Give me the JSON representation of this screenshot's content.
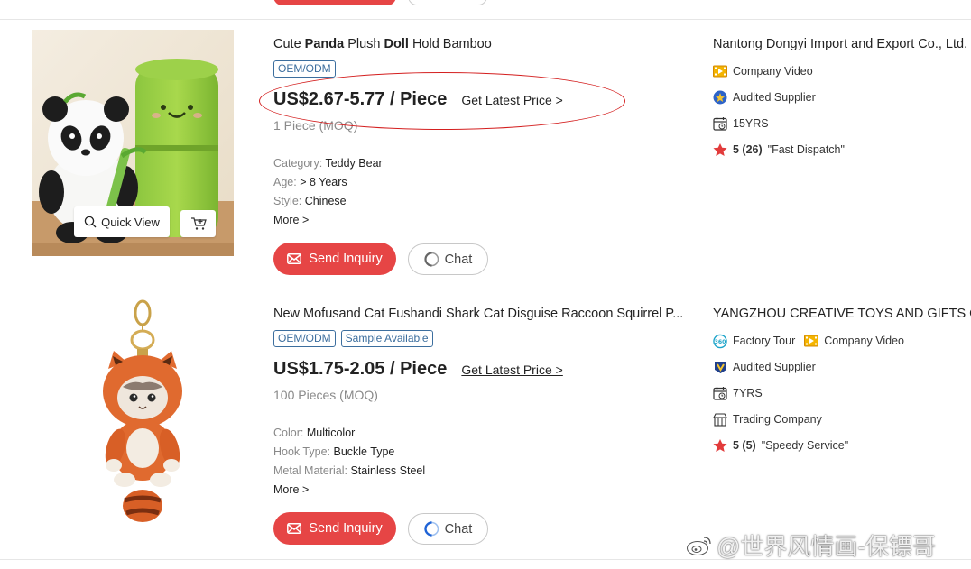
{
  "products": [
    {
      "title_parts": [
        {
          "text": "Cute ",
          "bold": false
        },
        {
          "text": "Panda",
          "bold": true
        },
        {
          "text": " Plush ",
          "bold": false
        },
        {
          "text": "Doll",
          "bold": true
        },
        {
          "text": " Hold Bamboo",
          "bold": false
        }
      ],
      "tags": [
        "OEM/ODM"
      ],
      "price": "US$2.67-5.77 / Piece",
      "latest_price_link": "Get Latest Price >",
      "moq": "1 Piece (MOQ)",
      "attributes": [
        {
          "key": "Category: ",
          "value": "Teddy Bear"
        },
        {
          "key": "Age: ",
          "value": "> 8 Years"
        },
        {
          "key": "Style: ",
          "value": "Chinese"
        }
      ],
      "more": "More >",
      "quick_view": "Quick View",
      "send_inquiry": "Send Inquiry",
      "chat": "Chat",
      "supplier": {
        "name": "Nantong Dongyi Import and Export Co., Ltd.",
        "company_video": "Company Video",
        "audited": "Audited Supplier",
        "years": "15YRS",
        "rating": "5 (26)",
        "rating_note": "\"Fast Dispatch\""
      }
    },
    {
      "title_text": "New Mofusand Cat Fushandi Shark Cat Disguise Raccoon Squirrel P...",
      "tags": [
        "OEM/ODM",
        "Sample Available"
      ],
      "price": "US$1.75-2.05 / Piece",
      "latest_price_link": "Get Latest Price >",
      "moq": "100 Pieces (MOQ)",
      "attributes": [
        {
          "key": "Color: ",
          "value": "Multicolor"
        },
        {
          "key": "Hook Type: ",
          "value": "Buckle Type"
        },
        {
          "key": "Metal Material: ",
          "value": "Stainless Steel"
        }
      ],
      "more": "More >",
      "send_inquiry": "Send Inquiry",
      "chat": "Chat",
      "supplier": {
        "name": "YANGZHOU CREATIVE TOYS AND GIFTS CO",
        "factory_tour": "Factory Tour",
        "company_video": "Company Video",
        "audited": "Audited Supplier",
        "years": "7YRS",
        "business_type": "Trading Company",
        "rating": "5 (5)",
        "rating_note": "\"Speedy Service\""
      }
    }
  ],
  "watermark": "@世界风情画-保镖哥",
  "colors": {
    "accent_red": "#e64545",
    "tag_blue": "#3c6e9e",
    "star_red": "#e23b3b",
    "annotation_red": "#d42020"
  }
}
